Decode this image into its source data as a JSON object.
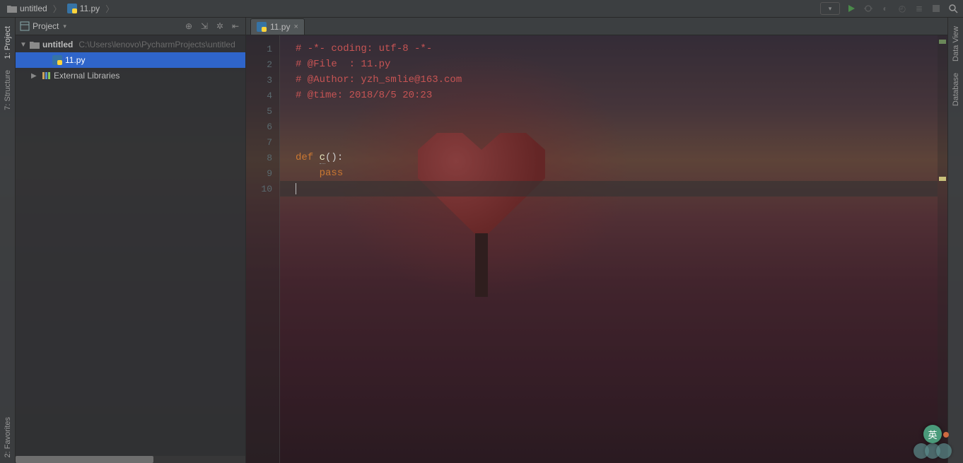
{
  "breadcrumb": {
    "project": "untitled",
    "file": "11.py"
  },
  "left_tabs": {
    "project": "1: Project",
    "structure": "7: Structure",
    "favorites": "2: Favorites"
  },
  "right_tabs": {
    "data_view": "Data View",
    "database": "Database"
  },
  "project_panel": {
    "title": "Project",
    "root": {
      "name": "untitled",
      "path": "C:\\Users\\lenovo\\PycharmProjects\\untitled"
    },
    "file": "11.py",
    "external": "External Libraries"
  },
  "editor": {
    "tab": "11.py",
    "lines": [
      {
        "n": 1,
        "type": "comment",
        "text": "# -*- coding: utf-8 -*-"
      },
      {
        "n": 2,
        "type": "comment",
        "text": "# @File  : 11.py"
      },
      {
        "n": 3,
        "type": "comment",
        "text": "# @Author: yzh_smlie@163.com"
      },
      {
        "n": 4,
        "type": "comment",
        "text": "# @time: 2018/8/5 20:23"
      },
      {
        "n": 5,
        "type": "blank",
        "text": ""
      },
      {
        "n": 6,
        "type": "blank",
        "text": ""
      },
      {
        "n": 7,
        "type": "blank",
        "text": ""
      },
      {
        "n": 8,
        "type": "def",
        "kw": "def ",
        "name": "c",
        "suffix": "():"
      },
      {
        "n": 9,
        "type": "pass",
        "indent": "    ",
        "text": "pass"
      },
      {
        "n": 10,
        "type": "current",
        "text": ""
      }
    ]
  },
  "ime": {
    "label": "英"
  }
}
